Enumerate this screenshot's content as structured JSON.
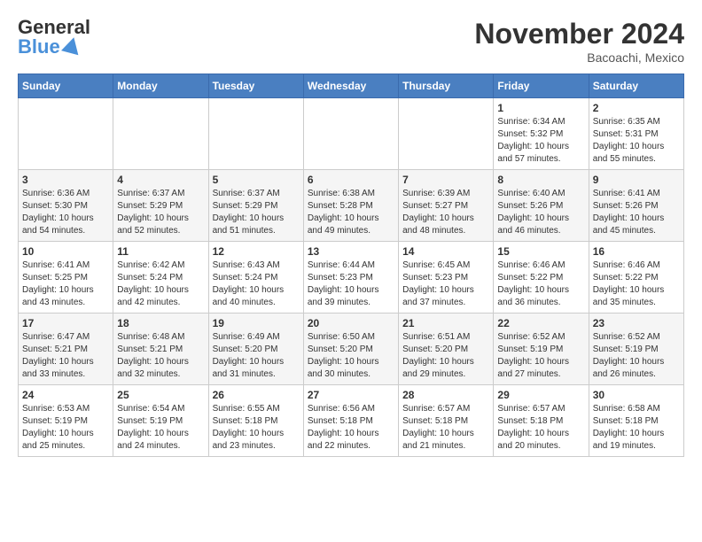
{
  "header": {
    "logo_general": "General",
    "logo_blue": "Blue",
    "month_title": "November 2024",
    "location": "Bacoachi, Mexico"
  },
  "days_of_week": [
    "Sunday",
    "Monday",
    "Tuesday",
    "Wednesday",
    "Thursday",
    "Friday",
    "Saturday"
  ],
  "weeks": [
    [
      {
        "day": "",
        "info": ""
      },
      {
        "day": "",
        "info": ""
      },
      {
        "day": "",
        "info": ""
      },
      {
        "day": "",
        "info": ""
      },
      {
        "day": "",
        "info": ""
      },
      {
        "day": "1",
        "info": "Sunrise: 6:34 AM\nSunset: 5:32 PM\nDaylight: 10 hours and 57 minutes."
      },
      {
        "day": "2",
        "info": "Sunrise: 6:35 AM\nSunset: 5:31 PM\nDaylight: 10 hours and 55 minutes."
      }
    ],
    [
      {
        "day": "3",
        "info": "Sunrise: 6:36 AM\nSunset: 5:30 PM\nDaylight: 10 hours and 54 minutes."
      },
      {
        "day": "4",
        "info": "Sunrise: 6:37 AM\nSunset: 5:29 PM\nDaylight: 10 hours and 52 minutes."
      },
      {
        "day": "5",
        "info": "Sunrise: 6:37 AM\nSunset: 5:29 PM\nDaylight: 10 hours and 51 minutes."
      },
      {
        "day": "6",
        "info": "Sunrise: 6:38 AM\nSunset: 5:28 PM\nDaylight: 10 hours and 49 minutes."
      },
      {
        "day": "7",
        "info": "Sunrise: 6:39 AM\nSunset: 5:27 PM\nDaylight: 10 hours and 48 minutes."
      },
      {
        "day": "8",
        "info": "Sunrise: 6:40 AM\nSunset: 5:26 PM\nDaylight: 10 hours and 46 minutes."
      },
      {
        "day": "9",
        "info": "Sunrise: 6:41 AM\nSunset: 5:26 PM\nDaylight: 10 hours and 45 minutes."
      }
    ],
    [
      {
        "day": "10",
        "info": "Sunrise: 6:41 AM\nSunset: 5:25 PM\nDaylight: 10 hours and 43 minutes."
      },
      {
        "day": "11",
        "info": "Sunrise: 6:42 AM\nSunset: 5:24 PM\nDaylight: 10 hours and 42 minutes."
      },
      {
        "day": "12",
        "info": "Sunrise: 6:43 AM\nSunset: 5:24 PM\nDaylight: 10 hours and 40 minutes."
      },
      {
        "day": "13",
        "info": "Sunrise: 6:44 AM\nSunset: 5:23 PM\nDaylight: 10 hours and 39 minutes."
      },
      {
        "day": "14",
        "info": "Sunrise: 6:45 AM\nSunset: 5:23 PM\nDaylight: 10 hours and 37 minutes."
      },
      {
        "day": "15",
        "info": "Sunrise: 6:46 AM\nSunset: 5:22 PM\nDaylight: 10 hours and 36 minutes."
      },
      {
        "day": "16",
        "info": "Sunrise: 6:46 AM\nSunset: 5:22 PM\nDaylight: 10 hours and 35 minutes."
      }
    ],
    [
      {
        "day": "17",
        "info": "Sunrise: 6:47 AM\nSunset: 5:21 PM\nDaylight: 10 hours and 33 minutes."
      },
      {
        "day": "18",
        "info": "Sunrise: 6:48 AM\nSunset: 5:21 PM\nDaylight: 10 hours and 32 minutes."
      },
      {
        "day": "19",
        "info": "Sunrise: 6:49 AM\nSunset: 5:20 PM\nDaylight: 10 hours and 31 minutes."
      },
      {
        "day": "20",
        "info": "Sunrise: 6:50 AM\nSunset: 5:20 PM\nDaylight: 10 hours and 30 minutes."
      },
      {
        "day": "21",
        "info": "Sunrise: 6:51 AM\nSunset: 5:20 PM\nDaylight: 10 hours and 29 minutes."
      },
      {
        "day": "22",
        "info": "Sunrise: 6:52 AM\nSunset: 5:19 PM\nDaylight: 10 hours and 27 minutes."
      },
      {
        "day": "23",
        "info": "Sunrise: 6:52 AM\nSunset: 5:19 PM\nDaylight: 10 hours and 26 minutes."
      }
    ],
    [
      {
        "day": "24",
        "info": "Sunrise: 6:53 AM\nSunset: 5:19 PM\nDaylight: 10 hours and 25 minutes."
      },
      {
        "day": "25",
        "info": "Sunrise: 6:54 AM\nSunset: 5:19 PM\nDaylight: 10 hours and 24 minutes."
      },
      {
        "day": "26",
        "info": "Sunrise: 6:55 AM\nSunset: 5:18 PM\nDaylight: 10 hours and 23 minutes."
      },
      {
        "day": "27",
        "info": "Sunrise: 6:56 AM\nSunset: 5:18 PM\nDaylight: 10 hours and 22 minutes."
      },
      {
        "day": "28",
        "info": "Sunrise: 6:57 AM\nSunset: 5:18 PM\nDaylight: 10 hours and 21 minutes."
      },
      {
        "day": "29",
        "info": "Sunrise: 6:57 AM\nSunset: 5:18 PM\nDaylight: 10 hours and 20 minutes."
      },
      {
        "day": "30",
        "info": "Sunrise: 6:58 AM\nSunset: 5:18 PM\nDaylight: 10 hours and 19 minutes."
      }
    ]
  ]
}
